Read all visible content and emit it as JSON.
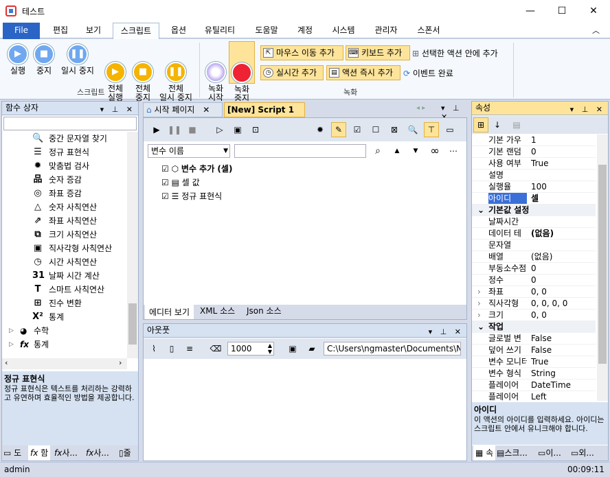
{
  "window": {
    "title": "테스트",
    "minimize": "—",
    "maximize": "☐",
    "close": "✕"
  },
  "menu": {
    "file": "File",
    "tabs": [
      "편집",
      "보기",
      "스크립트",
      "옵션",
      "유틸리티",
      "도움말",
      "계정",
      "시스템",
      "관리자",
      "스폰서"
    ],
    "collapse": "︿"
  },
  "ribbon": {
    "script_group": "스크립트",
    "record_group": "녹화",
    "buttons": [
      {
        "label": "실행",
        "icon": "play-icon"
      },
      {
        "label": "중지",
        "icon": "stop-icon"
      },
      {
        "label": "일시 중지",
        "icon": "pause-icon"
      },
      {
        "label": "전체\n실행",
        "icon": "play-all-icon"
      },
      {
        "label": "전체\n중지",
        "icon": "stop-all-icon"
      },
      {
        "label": "전체\n일시 중지",
        "icon": "pause-all-icon"
      },
      {
        "label": "녹화\n시작",
        "icon": "record-start-icon"
      },
      {
        "label": "녹화\n중지",
        "icon": "record-stop-icon"
      }
    ],
    "small": {
      "mouse": "마우스 이동 추가",
      "keyboard": "키보드 추가",
      "insert_selected": "선택한 액션 안에 추가",
      "realtime": "실시간 추가",
      "action_instant": "액션 즉시 추가",
      "event_done": "이벤트 완료"
    }
  },
  "function_panel": {
    "title": "함수 상자",
    "search_value": "",
    "items": [
      "중간 문자열 찾기",
      "정규 표현식",
      "맞춤법 검사",
      "숫자 증감",
      "좌표 증감",
      "숫자 사칙연산",
      "좌표 사칙연산",
      "크기 사칙연산",
      "직사각형 사칙연산",
      "시간 사칙연산",
      "날짜 시간 계산",
      "스마트 사칙연산",
      "진수 변환",
      "통계"
    ],
    "item_icons": [
      "🔍",
      "☰",
      "✹",
      "品",
      "◎",
      "△",
      "⇗",
      "⧉",
      "▣",
      "◷",
      "31",
      "T",
      "⊞",
      "X²"
    ],
    "groups": [
      "수학",
      "통계"
    ],
    "desc_title": "정규 표현식",
    "desc_text": "정규 표현식은 텍스트를 처리하는 강력하고 유연하며 효율적인 방법을 제공합니다.",
    "bottom_tabs": [
      "도",
      "함",
      "사...",
      "사...",
      "줄"
    ]
  },
  "editor": {
    "tabs": [
      "시작 페이지",
      "[New] Script 1"
    ],
    "combo_value": "변수 이름",
    "filter_value": "",
    "tree": [
      {
        "label": "변수 추가 (셀)",
        "bold": true
      },
      {
        "label": "셀 값",
        "bold": false
      },
      {
        "label": "정규 표현식",
        "bold": false
      }
    ],
    "view_tabs": [
      "에디터 보기",
      "XML 소스",
      "Json 소스"
    ]
  },
  "output": {
    "title": "아웃풋",
    "count": "1000",
    "path": "C:\\Users\\ngmaster\\Documents\\NGM"
  },
  "properties": {
    "title": "속성",
    "rows": [
      {
        "k": "기본 가우",
        "v": "1"
      },
      {
        "k": "기본 랜덤",
        "v": "0"
      },
      {
        "k": "사용 여부",
        "v": "True"
      },
      {
        "k": "설명",
        "v": ""
      },
      {
        "k": "실행율",
        "v": "100"
      },
      {
        "k": "아이디",
        "v": "셀",
        "sel": true
      },
      {
        "cat": "기본값 설정"
      },
      {
        "k": "날짜시간",
        "v": ""
      },
      {
        "k": "데이터 테",
        "v": "(없음)",
        "bold": true
      },
      {
        "k": "문자열",
        "v": ""
      },
      {
        "k": "배열",
        "v": "(없음)"
      },
      {
        "k": "부동소수점",
        "v": "0"
      },
      {
        "k": "정수",
        "v": "0"
      },
      {
        "k": "좌표",
        "v": "0, 0",
        "exp": true
      },
      {
        "k": "직사각형",
        "v": "0, 0, 0, 0",
        "exp": true
      },
      {
        "k": "크기",
        "v": "0, 0",
        "exp": true
      },
      {
        "cat": "작업"
      },
      {
        "k": "글로벌 변",
        "v": "False"
      },
      {
        "k": "덮어 쓰기",
        "v": "False"
      },
      {
        "k": "변수 모니터",
        "v": "True"
      },
      {
        "k": "변수 형식",
        "v": "String"
      },
      {
        "k": "플레이어",
        "v": "DateTime"
      },
      {
        "k": "플레이어",
        "v": "Left"
      }
    ],
    "desc_title": "아이디",
    "desc_text": "이 액션의 아이디를 입력하세요. 아이디는 스크립트 안에서 유니크해야 합니다.",
    "bottom_tabs": [
      "속",
      "스크...",
      "이...",
      "외..."
    ]
  },
  "status": {
    "user": "admin",
    "time": "00:09:11"
  }
}
